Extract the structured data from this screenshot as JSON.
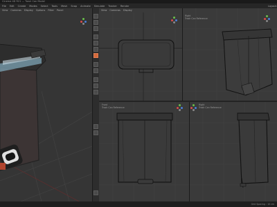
{
  "window": {
    "title": "Cinema 4D R21 — Trash Can Model"
  },
  "menubar": {
    "items": [
      "File",
      "Edit",
      "Create",
      "Modes",
      "Select",
      "Tools",
      "Mesh",
      "Snap",
      "Animate",
      "Simulate",
      "Tracker",
      "Render"
    ],
    "layout_label": "Layout:"
  },
  "viewports": {
    "perspective": {
      "menu": [
        "View",
        "Cameras",
        "Display",
        "Options",
        "Filter",
        "Panel"
      ],
      "name": "Perspective"
    },
    "top": {
      "menu": [
        "View",
        "Cameras",
        "Display"
      ],
      "name": "Top",
      "info": [
        "Trash Can Reference",
        "C:\\Users\\ref\\trash_can_top_ref.jpg"
      ]
    },
    "right": {
      "name": "Right",
      "info": [
        "Trash Can Reference",
        "C:\\Users\\ref\\trash_can_right_ref.jpg"
      ]
    },
    "front": {
      "name": "Front",
      "info": [
        "Trash Can Reference",
        "C:\\Users\\ref\\trash_can_front_ref.jpg"
      ]
    },
    "side": {
      "name": "Right",
      "info": [
        "Trash Can Reference",
        "C:\\Users\\ref\\trash_can_side_ref.jpg"
      ]
    }
  },
  "status": {
    "left": "",
    "right": "Grid Spacing : 10 cm"
  },
  "colors": {
    "tool_active": "#d46a3c",
    "gizmo_x": "#d94b4b",
    "gizmo_y": "#6ac14a",
    "gizmo_z": "#4a7fd9"
  }
}
